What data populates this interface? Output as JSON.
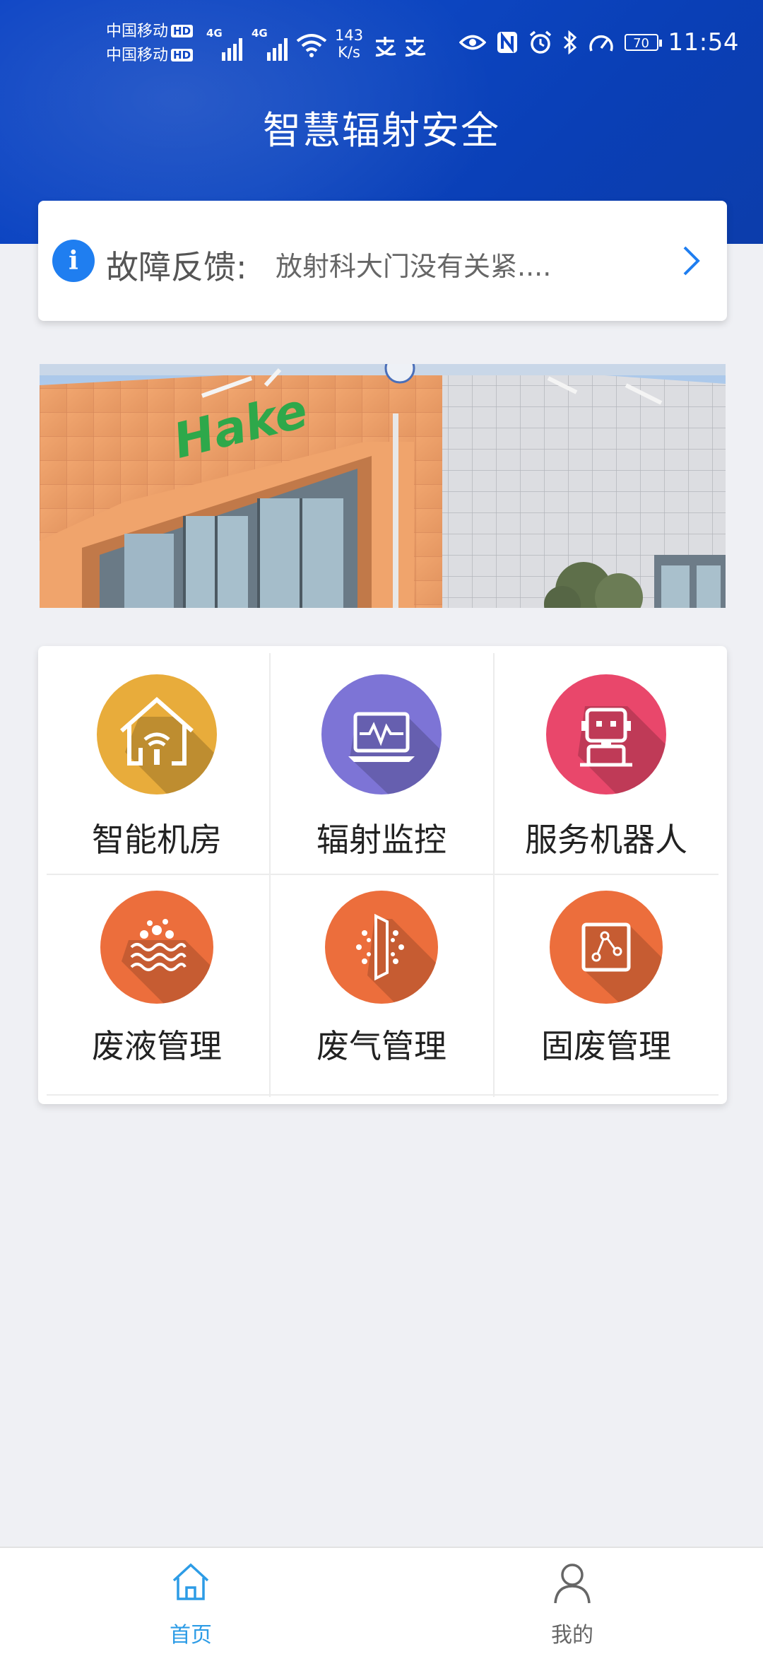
{
  "status_bar": {
    "carrier1": "中国移动",
    "carrier2": "中国移动",
    "hd_badge": "HD",
    "net1": "4G",
    "net2": "4G",
    "speed_value": "143",
    "speed_unit": "K/s",
    "battery": "70",
    "time": "11:54"
  },
  "header": {
    "title": "智慧辐射安全"
  },
  "notice": {
    "info_glyph": "i",
    "label": "故障反馈:",
    "message": "放射科大门没有关紧...."
  },
  "banner": {
    "logo_text": "Hake"
  },
  "grid": {
    "items": [
      {
        "label": "智能机房",
        "icon": "smart-room-icon",
        "color": "#e8ac3b"
      },
      {
        "label": "辐射监控",
        "icon": "radiation-monitor-icon",
        "color": "#7d74d6"
      },
      {
        "label": "服务机器人",
        "icon": "robot-icon",
        "color": "#e9476b"
      },
      {
        "label": "废液管理",
        "icon": "waste-liquid-icon",
        "color": "#ec6e3c"
      },
      {
        "label": "废气管理",
        "icon": "waste-gas-icon",
        "color": "#ec6e3c"
      },
      {
        "label": "固废管理",
        "icon": "solid-waste-icon",
        "color": "#ec6e3c"
      }
    ]
  },
  "tabbar": {
    "home_label": "首页",
    "mine_label": "我的",
    "active_color": "#2d9ce6"
  }
}
